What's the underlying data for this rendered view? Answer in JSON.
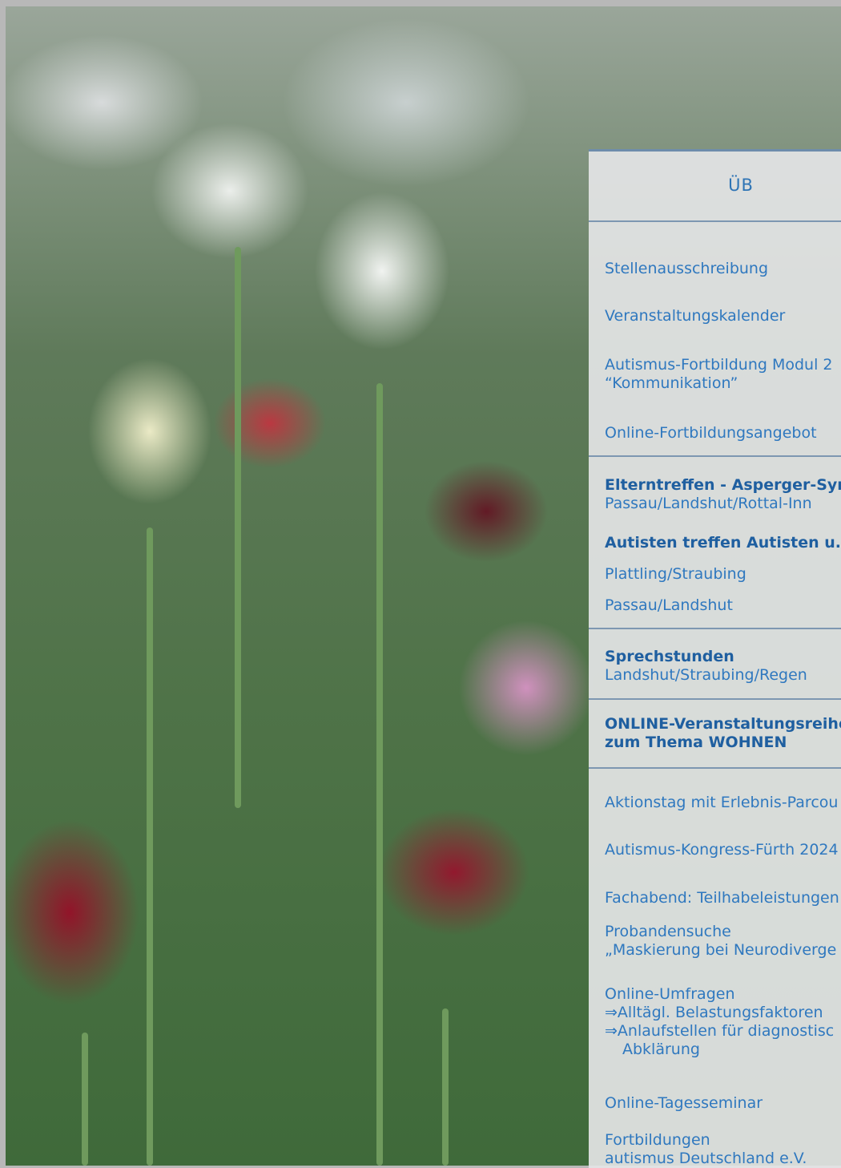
{
  "panel": {
    "title": "ÜB",
    "items": [
      {
        "label": "Stellenausschreibung"
      },
      {
        "label": "Veranstaltungskalender"
      },
      {
        "label": "Autismus-Fortbildung Modul 2",
        "sub": "“Kommunikation”"
      },
      {
        "label": "Online-Fortbildungsangebot"
      },
      {
        "label": "Elterntreffen - Asperger-Syndr",
        "sub": "Passau/Landshut/Rottal-Inn"
      },
      {
        "label": "Autisten treffen Autisten u. Fr"
      },
      {
        "label": "Plattling/Straubing"
      },
      {
        "label": "Passau/Landshut"
      },
      {
        "label": "Sprechstunden",
        "sub": "Landshut/Straubing/Regen"
      },
      {
        "label": "ONLINE-Veranstaltungsreihe",
        "sub": "zum Thema WOHNEN"
      },
      {
        "label": "Aktionstag mit Erlebnis-Parcou"
      },
      {
        "label": "Autismus-Kongress-Fürth 2024"
      },
      {
        "label": "Fachabend: Teilhabeleistungen"
      },
      {
        "label": "Probandensuche",
        "sub": "„Maskierung bei Neurodiverge"
      },
      {
        "label": "Online-Umfragen",
        "sub": "⇒Alltägl. Belastungsfaktoren",
        "sub2": "⇒Anlaufstellen für diagnostisc",
        "sub3": "Abklärung"
      },
      {
        "label": "Online-Tagesseminar"
      },
      {
        "label": "Fortbildungen",
        "sub": "autismus Deutschland e.V."
      }
    ]
  }
}
